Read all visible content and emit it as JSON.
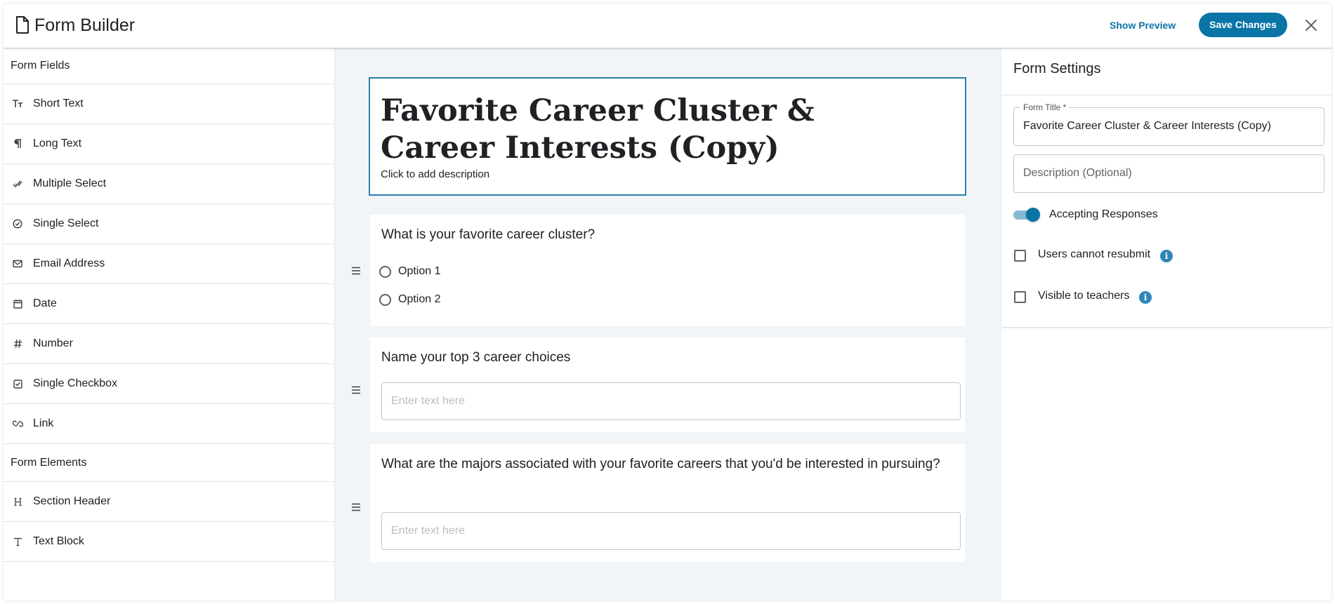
{
  "header": {
    "title": "Form Builder",
    "preview_label": "Show Preview",
    "save_label": "Save Changes"
  },
  "sidebar": {
    "fields_heading": "Form Fields",
    "fields": [
      {
        "label": "Short Text",
        "icon": "text-size-icon"
      },
      {
        "label": "Long Text",
        "icon": "paragraph-icon"
      },
      {
        "label": "Multiple Select",
        "icon": "double-check-icon"
      },
      {
        "label": "Single Select",
        "icon": "check-circle-icon"
      },
      {
        "label": "Email Address",
        "icon": "mail-icon"
      },
      {
        "label": "Date",
        "icon": "calendar-icon"
      },
      {
        "label": "Number",
        "icon": "hash-icon"
      },
      {
        "label": "Single Checkbox",
        "icon": "checkbox-icon"
      },
      {
        "label": "Link",
        "icon": "link-icon"
      }
    ],
    "elements_heading": "Form Elements",
    "elements": [
      {
        "label": "Section Header",
        "icon": "heading-icon"
      },
      {
        "label": "Text Block",
        "icon": "text-icon"
      }
    ]
  },
  "form": {
    "title": "Favorite Career Cluster & Career Interests (Copy)",
    "description": "Click to add description",
    "questions": [
      {
        "label": "What is your favorite career cluster?",
        "options": [
          "Option 1",
          "Option 2"
        ]
      },
      {
        "label": "Name your top 3 career choices",
        "placeholder": "Enter text here"
      },
      {
        "label": "What are the majors associated with your favorite careers that you'd be interested in pursuing?",
        "placeholder": "Enter text here"
      }
    ]
  },
  "settings": {
    "heading": "Form Settings",
    "title_label": "Form Title *",
    "title_value": "Favorite Career Cluster & Career Interests (Copy)",
    "description_placeholder": "Description (Optional)",
    "accepting_label": "Accepting Responses",
    "accepting_on": true,
    "resubmit_label": "Users cannot resubmit",
    "visible_label": "Visible to teachers"
  },
  "colors": {
    "accent": "#0a74a6",
    "canvas_bg": "#f1f5f8"
  }
}
